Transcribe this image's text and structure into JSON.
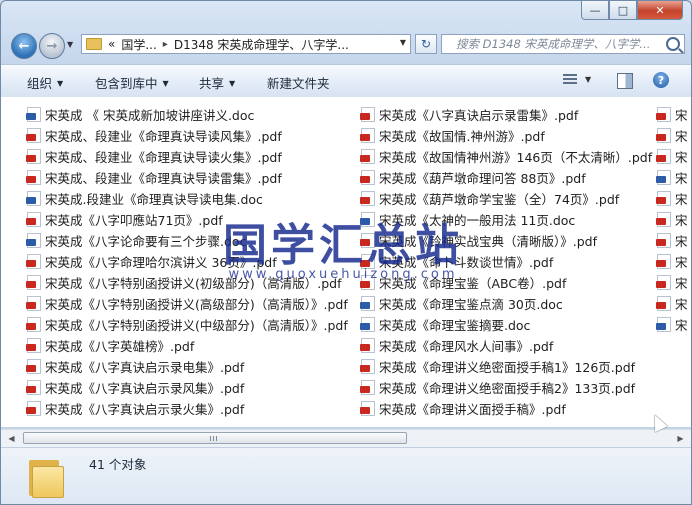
{
  "window": {
    "caption": {
      "minimize": "—",
      "maximize": "□",
      "close": "✕"
    }
  },
  "nav": {
    "back": "←",
    "forward": "→",
    "address": {
      "prefix": "«",
      "segments": [
        "国学...",
        "D1348 宋英成命理学、八字学..."
      ]
    },
    "search_placeholder": "搜索 D1348 宋英成命理学、八字学..."
  },
  "toolbar": {
    "organize": "组织",
    "include_in_library": "包含到库中",
    "share": "共享",
    "new_folder": "新建文件夹"
  },
  "files": {
    "col1": [
      {
        "name": "宋英成 《 宋英成新加坡讲座讲义.doc",
        "type": "doc"
      },
      {
        "name": "宋英成、段建业《命理真诀导读风集》.pdf",
        "type": "pdf"
      },
      {
        "name": "宋英成、段建业《命理真诀导读火集》.pdf",
        "type": "pdf"
      },
      {
        "name": "宋英成、段建业《命理真诀导读雷集》.pdf",
        "type": "pdf"
      },
      {
        "name": "宋英成.段建业《命理真诀导读电集.doc",
        "type": "doc"
      },
      {
        "name": "宋英成《八字叩應站71页》.pdf",
        "type": "pdf"
      },
      {
        "name": "宋英成《八字论命要有三个步骤.doc",
        "type": "doc"
      },
      {
        "name": "宋英成《八字命理哈尔滨讲义 36页》.pdf",
        "type": "pdf"
      },
      {
        "name": "宋英成《八字特别函授讲义(初级部分)（高清版）.pdf",
        "type": "pdf"
      },
      {
        "name": "宋英成《八字特别函授讲义(高级部分)（高清版）》.pdf",
        "type": "pdf"
      },
      {
        "name": "宋英成《八字特别函授讲义(中级部分)（高清版）》.pdf",
        "type": "pdf"
      },
      {
        "name": "宋英成《八字英雄榜》.pdf",
        "type": "pdf"
      },
      {
        "name": "宋英成《八字真诀启示录电集》.pdf",
        "type": "pdf"
      },
      {
        "name": "宋英成《八字真诀启示录风集》.pdf",
        "type": "pdf"
      },
      {
        "name": "宋英成《八字真诀启示录火集》.pdf",
        "type": "pdf"
      }
    ],
    "col2": [
      {
        "name": "宋英成《八字真诀启示录雷集》.pdf",
        "type": "pdf"
      },
      {
        "name": "宋英成《故国情.神州游》.pdf",
        "type": "pdf"
      },
      {
        "name": "宋英成《故国情神州游》146页（不太清晰）.pdf",
        "type": "pdf"
      },
      {
        "name": "宋英成《葫芦墩命理问答 88页》.pdf",
        "type": "pdf"
      },
      {
        "name": "宋英成《葫芦墩命学宝鉴（全）74页》.pdf",
        "type": "pdf"
      },
      {
        "name": "宋英成《太神的一般用法 11页.doc",
        "type": "doc"
      },
      {
        "name": "宋英成《铃神实战宝典（清晰版）》.pdf",
        "type": "pdf"
      },
      {
        "name": "宋英成《命卜斗数谈世情》.pdf",
        "type": "pdf"
      },
      {
        "name": "宋英成《命理宝鉴（ABC卷）.pdf",
        "type": "pdf"
      },
      {
        "name": "宋英成《命理宝鉴点滴 30页.doc",
        "type": "doc"
      },
      {
        "name": "宋英成《命理宝鉴摘要.doc",
        "type": "doc"
      },
      {
        "name": "宋英成《命理风水人间事》.pdf",
        "type": "pdf"
      },
      {
        "name": "宋英成《命理讲义绝密面授手稿1》126页.pdf",
        "type": "pdf"
      },
      {
        "name": "宋英成《命理讲义绝密面授手稿2》133页.pdf",
        "type": "pdf"
      },
      {
        "name": "宋英成《命理讲义面授手稿》.pdf",
        "type": "pdf"
      }
    ],
    "col3": [
      {
        "name": "宋",
        "type": "pdf"
      },
      {
        "name": "宋",
        "type": "pdf"
      },
      {
        "name": "宋",
        "type": "pdf"
      },
      {
        "name": "宋",
        "type": "doc"
      },
      {
        "name": "宋",
        "type": "pdf"
      },
      {
        "name": "宋",
        "type": "pdf"
      },
      {
        "name": "宋",
        "type": "pdf"
      },
      {
        "name": "宋",
        "type": "pdf"
      },
      {
        "name": "宋",
        "type": "pdf"
      },
      {
        "name": "宋",
        "type": "pdf"
      },
      {
        "name": "宋",
        "type": "doc"
      }
    ]
  },
  "watermark": {
    "title": "国学汇总站",
    "url": "www.guoxuehuizong.com"
  },
  "status": {
    "count": "41 个对象"
  }
}
